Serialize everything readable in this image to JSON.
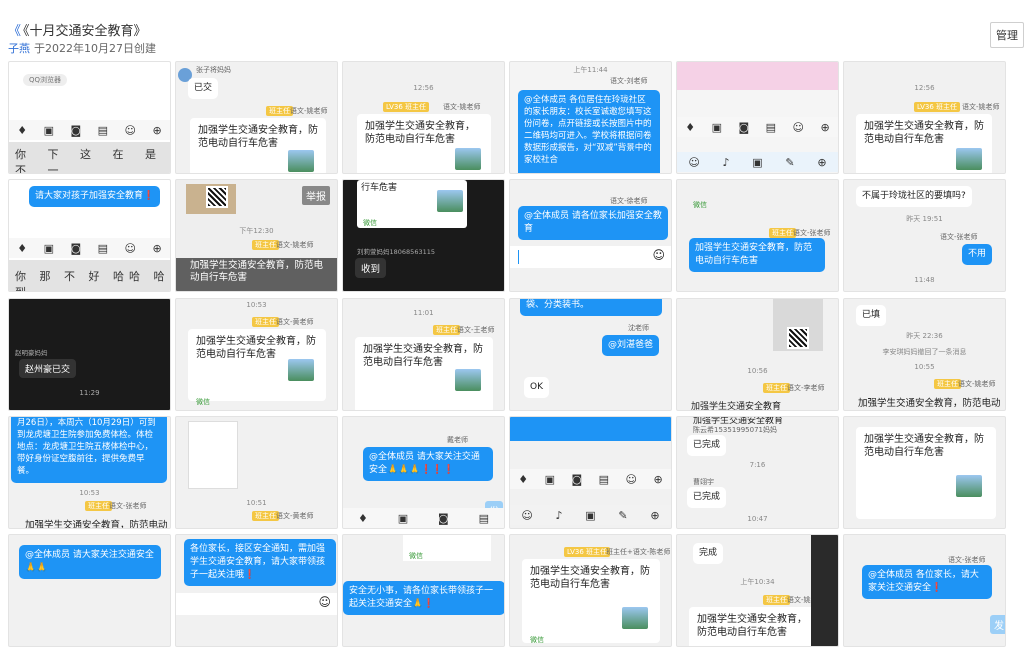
{
  "header": {
    "title": "《十月交通安全教育》",
    "title_quote": "《",
    "author": "子燕",
    "created": "于2022年10月27日创建",
    "manage_label": "管理"
  },
  "common": {
    "safety_text": "加强学生交通安全教育，防范电动自行车危害",
    "class_teacher_badge": "班主任",
    "chinese_teacher_zhang": "语文-张老师",
    "chinese_teacher_yao": "语文-姚老师",
    "chinese_teacher_huang": "语文-黄老师",
    "chinese_teacher_wang": "语文-王老师",
    "chinese_teacher_li": "语文-李老师",
    "wechat": "微信",
    "keys_row": "你 下 这 在 是 不 一",
    "keys_row2": "你 那 不 好 哈哈 哈 到"
  },
  "cells": {
    "c1": {
      "chip": "QQ浏览器"
    },
    "c2": {
      "name": "张子将妈妈",
      "msg": "已交"
    },
    "c3": {
      "time": "12:56"
    },
    "c4": {
      "time": "上午11:44",
      "sender": "语文-刘老师",
      "msg": "@全体成员 各位居住在玲珑社区的家长朋友：校长室诚邀您填写这份问卷，点开链接或长按图片中的二维码均可进入。学校将根据问卷数据形成报告，对“双减”背景中的家校社合"
    },
    "c6": {
      "time": "12:56"
    },
    "c7": {
      "msg": "请大家对孩子加强安全教育❗"
    },
    "c8": {
      "report": "举报",
      "time": "下午12:30",
      "overlay": "加强学生交通安全教育，防范电动自行车危害"
    },
    "c9": {
      "top": "行车危害",
      "phone": "刘莉萱妈妈18068563115",
      "reply": "收到"
    },
    "c10": {
      "sender": "语文-徐老师",
      "msg": "@全体成员 请各位家长加强安全教育"
    },
    "c12": {
      "msg": "不属于玲珑社区的要填吗?",
      "time": "昨天 19:51",
      "sender": "语文-张老师",
      "reply": "不用",
      "time2": "11:48"
    },
    "c13": {
      "name": "赵明豪妈妈",
      "msg": "赵州豪已交",
      "time": "11:29"
    },
    "c14": {
      "time": "10:53"
    },
    "c15": {
      "time": "11:01"
    },
    "c16": {
      "top": "袋、分类装书。",
      "sender": "沈老师",
      "mention": "@刘湛爸爸",
      "reply": "OK"
    },
    "c17": {
      "time": "10:56",
      "bottom": "加强学生交通安全教育"
    },
    "c18": {
      "msg": "已填",
      "time": "昨天 22:36",
      "recall": "李安琪妈妈撤回了一条消息",
      "time2": "10:55"
    },
    "c19": {
      "msg": "月26日），本周六（10月29日）可到到龙虎塘卫生院参加免费体检。体检地点：龙虎塘卫生院五楼体检中心，带好身份证空腹前往，提供免费早餐。",
      "time": "10:53"
    },
    "c20": {
      "time": "10:51"
    },
    "c21": {
      "name": "戴老师",
      "msg": "@全体成员 请大家关注交通安全🙏🙏🙏❗❗❗",
      "send": "发"
    },
    "c23": {
      "top": "加强学生交通安全教育",
      "msg1": "已完成",
      "time": "7:16",
      "msg2": "已完成",
      "time2": "10:47",
      "name": "陈云希15351995071妈妈",
      "name2": "曹翊宇"
    },
    "c25": {
      "msg": "@全体成员 请大家关注交通安全🙏🙏"
    },
    "c26": {
      "msg": "各位家长，接区安全通知，需加强学生交通安全教育，请大家带领孩子一起关注哦❗"
    },
    "c27": {
      "msg": "安全无小事，请各位家长带领孩子一起关注交通安全🙏❗"
    },
    "c28": {
      "sender": "班主任+语文-陈老师"
    },
    "c29": {
      "msg": "完成",
      "time": "上午10:34"
    },
    "c30": {
      "sender": "语文-张老师",
      "msg": "@全体成员 各位家长，请大家关注交通安全❗",
      "send": "发"
    }
  }
}
